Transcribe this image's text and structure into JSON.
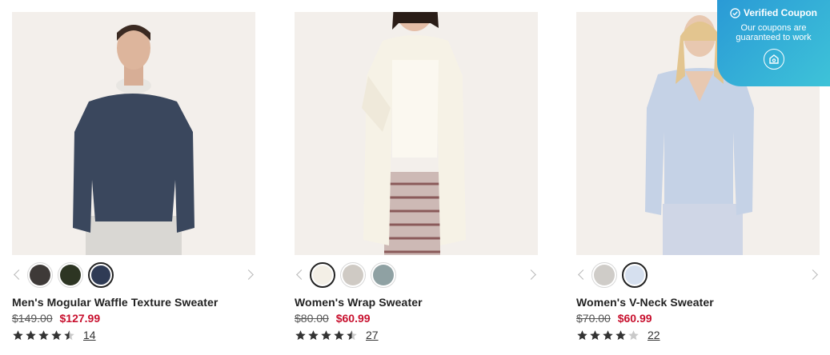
{
  "products": [
    {
      "name": "Men's Mogular Waffle Texture Sweater",
      "original_price": "$149.00",
      "sale_price": "$127.99",
      "rating": 4.5,
      "review_count": "14",
      "swatches": [
        {
          "color": "#3e3a38",
          "selected": false
        },
        {
          "color": "#2d3523",
          "selected": false
        },
        {
          "color": "#2f3b55",
          "selected": true
        }
      ]
    },
    {
      "name": "Women's Wrap Sweater",
      "original_price": "$80.00",
      "sale_price": "$60.99",
      "rating": 4.5,
      "review_count": "27",
      "swatches": [
        {
          "color": "#f3efe6",
          "selected": true
        },
        {
          "color": "#cfcac4",
          "selected": false
        },
        {
          "color": "#8fa1a3",
          "selected": false
        }
      ]
    },
    {
      "name": "Women's V-Neck Sweater",
      "original_price": "$70.00",
      "sale_price": "$60.99",
      "rating": 4,
      "review_count": "22",
      "swatches": [
        {
          "color": "#cfccc8",
          "selected": false
        },
        {
          "color": "#d6e0ef",
          "selected": true
        }
      ]
    }
  ],
  "coupon": {
    "title": "Verified Coupon",
    "subtitle": "Our coupons are guaranteed to work"
  },
  "colors": {
    "sale_red": "#c8102e",
    "image_bg": "#f3efeb"
  }
}
